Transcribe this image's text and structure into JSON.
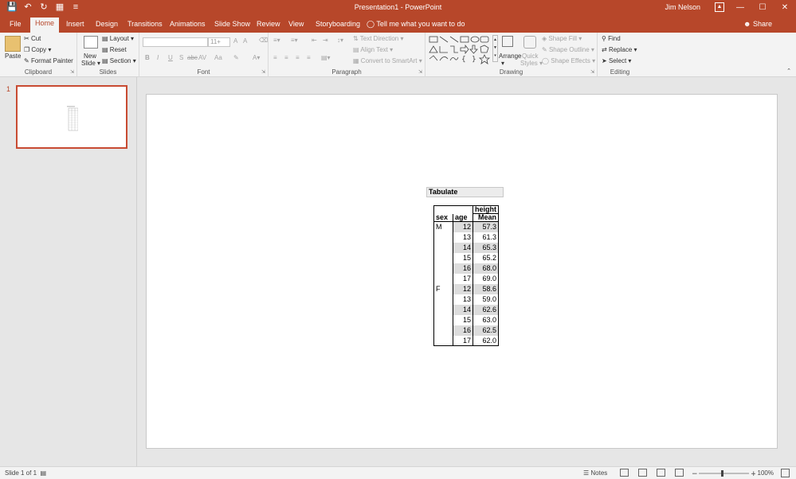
{
  "titlebar": {
    "title": "Presentation1 - PowerPoint",
    "user": "Jim Nelson"
  },
  "tabs": [
    "File",
    "Home",
    "Insert",
    "Design",
    "Transitions",
    "Animations",
    "Slide Show",
    "Review",
    "View",
    "Storyboarding"
  ],
  "active_tab": "Home",
  "tell_me": "Tell me what you want to do",
  "share": "Share",
  "ribbon": {
    "clipboard": {
      "label": "Clipboard",
      "paste": "Paste",
      "cut": "Cut",
      "copy": "Copy",
      "format_painter": "Format Painter"
    },
    "slides": {
      "label": "Slides",
      "new_slide_1": "New",
      "new_slide_2": "Slide",
      "layout": "Layout",
      "reset": "Reset",
      "section": "Section"
    },
    "font": {
      "label": "Font",
      "size": "11+",
      "bold": "B",
      "italic": "I",
      "underline": "U",
      "shadow": "S",
      "strike": "abc",
      "spacing": "AV",
      "case": "Aa",
      "grow": "A",
      "shrink": "A"
    },
    "paragraph": {
      "label": "Paragraph",
      "text_direction": "Text Direction",
      "align_text": "Align Text",
      "smartart": "Convert to SmartArt"
    },
    "drawing": {
      "label": "Drawing",
      "arrange": "Arrange",
      "quick_styles_1": "Quick",
      "quick_styles_2": "Styles",
      "shape_fill": "Shape Fill",
      "shape_outline": "Shape Outline",
      "shape_effects": "Shape Effects"
    },
    "editing": {
      "label": "Editing",
      "find": "Find",
      "replace": "Replace",
      "select": "Select"
    }
  },
  "thumbnails": {
    "slide_number": "1"
  },
  "tabulate": {
    "title": "Tabulate",
    "header_var": "height",
    "col_sex": "sex",
    "col_age": "age",
    "col_stat": "Mean",
    "rows": [
      {
        "sex": "M",
        "age": "12",
        "mean": "57.3"
      },
      {
        "sex": "",
        "age": "13",
        "mean": "61.3"
      },
      {
        "sex": "",
        "age": "14",
        "mean": "65.3"
      },
      {
        "sex": "",
        "age": "15",
        "mean": "65.2"
      },
      {
        "sex": "",
        "age": "16",
        "mean": "68.0"
      },
      {
        "sex": "",
        "age": "17",
        "mean": "69.0"
      },
      {
        "sex": "F",
        "age": "12",
        "mean": "58.6"
      },
      {
        "sex": "",
        "age": "13",
        "mean": "59.0"
      },
      {
        "sex": "",
        "age": "14",
        "mean": "62.6"
      },
      {
        "sex": "",
        "age": "15",
        "mean": "63.0"
      },
      {
        "sex": "",
        "age": "16",
        "mean": "62.5"
      },
      {
        "sex": "",
        "age": "17",
        "mean": "62.0"
      }
    ]
  },
  "statusbar": {
    "slide_info": "Slide 1 of 1",
    "notes": "Notes",
    "zoom": "100%"
  },
  "colors": {
    "accent": "#b7472a"
  }
}
